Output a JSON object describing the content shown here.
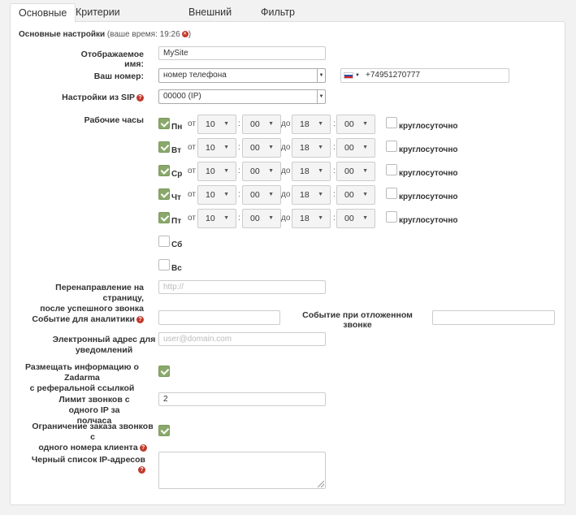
{
  "tabs": [
    "Основные",
    "Критерии отображения",
    "Внешний вид",
    "Фильтр номеров"
  ],
  "section": {
    "title": "Основные настройки",
    "time_note": "(ваше время: 19:26"
  },
  "fields": {
    "display_name": {
      "label": "Отображаемое имя:",
      "value": "MySite"
    },
    "your_number": {
      "label": "Ваш номер:",
      "select": "номер телефона",
      "phone": "+74951270777",
      "flag": "russia-flag-icon"
    },
    "sip": {
      "label": "Настройки из SIP",
      "select": "00000 (IP)"
    },
    "hours": {
      "label": "Рабочие часы"
    },
    "redirect": {
      "label_line1": "Перенаправление на страницу,",
      "label_line2": "после успешного звонка",
      "placeholder": "http://"
    },
    "analytics": {
      "label": "Событие для аналитики",
      "value": ""
    },
    "deferred": {
      "label": "Событие при отложенном звонке",
      "value": ""
    },
    "email": {
      "label_line1": "Электронный адрес для",
      "label_line2": "уведомлений",
      "placeholder": "user@domain.com"
    },
    "zadarma_ref": {
      "label_line1": "Размещать информацию о Zadarma",
      "label_line2": "с реферальной ссылкой",
      "checked": true
    },
    "call_limit": {
      "label_line1": "Лимит звонков с одного IP за",
      "label_line2": "полчаса",
      "value": "2"
    },
    "order_limit": {
      "label_line1": "Ограничение заказа звонков с",
      "label_line2": "одного номера клиента",
      "checked": true
    },
    "blacklist": {
      "label": "Черный список IP-адресов",
      "value": ""
    }
  },
  "hours_text": {
    "from": "от",
    "to": "до",
    "sep": ":",
    "round_clock": "круглосуточно"
  },
  "days": [
    {
      "label": "Пн",
      "checked": true,
      "from_h": "10",
      "from_m": "00",
      "to_h": "18",
      "to_m": "00"
    },
    {
      "label": "Вт",
      "checked": true,
      "from_h": "10",
      "from_m": "00",
      "to_h": "18",
      "to_m": "00"
    },
    {
      "label": "Ср",
      "checked": true,
      "from_h": "10",
      "from_m": "00",
      "to_h": "18",
      "to_m": "00"
    },
    {
      "label": "Чт",
      "checked": true,
      "from_h": "10",
      "from_m": "00",
      "to_h": "18",
      "to_m": "00"
    },
    {
      "label": "Пт",
      "checked": true,
      "from_h": "10",
      "from_m": "00",
      "to_h": "18",
      "to_m": "00"
    },
    {
      "label": "Сб",
      "checked": false
    },
    {
      "label": "Вс",
      "checked": false
    }
  ],
  "colors": {
    "check_green": "#8aa86b",
    "help_red": "#c0392b"
  }
}
